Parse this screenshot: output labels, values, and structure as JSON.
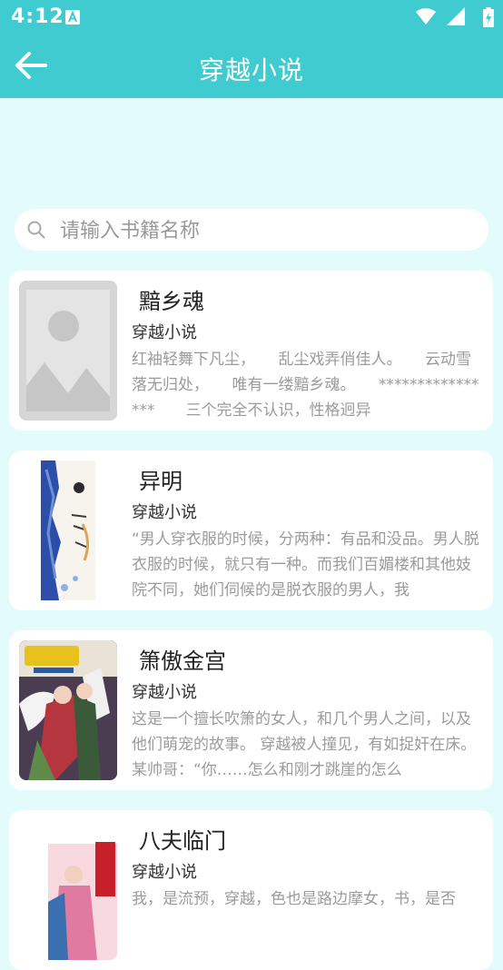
{
  "status": {
    "time": "4:12"
  },
  "appbar": {
    "title": "穿越小说"
  },
  "search": {
    "placeholder": "请输入书籍名称"
  },
  "books": [
    {
      "title": "黯乡魂",
      "category": "穿越小说",
      "description": "红袖轻舞下凡尘，　　乱尘戏弄俏佳人。　　云动雪落无归处，　　唯有一缕黯乡魂。　　****************　　三个完全不认识，性格迥异",
      "cover": "placeholder"
    },
    {
      "title": "异明",
      "category": "穿越小说",
      "description": "“男人穿衣服的时候，分两种：有品和没品。男人脱衣服的时候，就只有一种。而我们百媚楼和其他妓院不同，她们伺候的是脱衣服的男人，我",
      "cover": "blue-white"
    },
    {
      "title": "箫傲金宫",
      "category": "穿越小说",
      "description": "这是一个擅长吹箫的女人，和几个男人之间，以及他们萌宠的故事。 穿越被人撞见，有如捉奸在床。 某帅哥：“你……怎么和刚才跳崖的怎么",
      "cover": "illustrated"
    },
    {
      "title": "八夫临门",
      "category": "穿越小说",
      "description": "我，是流预，穿越，色也是路边摩女，书，是否",
      "cover": "pink"
    }
  ]
}
